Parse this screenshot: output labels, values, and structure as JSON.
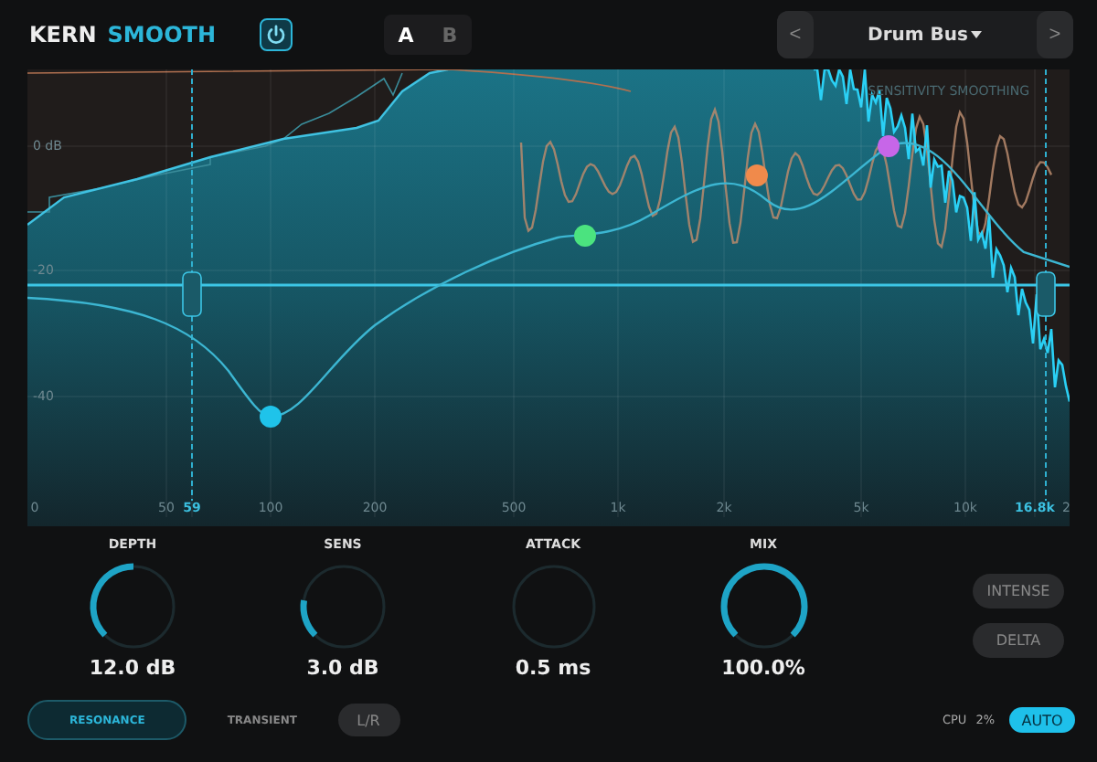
{
  "header": {
    "brand": "KERN",
    "mode": "SMOOTH",
    "power": {
      "on": true
    },
    "ab": [
      {
        "label": "A",
        "selected": true
      },
      {
        "label": "B",
        "selected": false
      }
    ],
    "preset": {
      "prev": "<",
      "name": "Drum Bus",
      "next": ">"
    }
  },
  "graph": {
    "db_labels": [
      "0 dB",
      "-20",
      "-40"
    ],
    "overlay_label": "SENSITIVITY SMOOTHING",
    "freq_labels": [
      {
        "text": "0",
        "kind": "tick"
      },
      {
        "text": "50",
        "kind": "tick"
      },
      {
        "text": "59",
        "kind": "band"
      },
      {
        "text": "100",
        "kind": "tick"
      },
      {
        "text": "200",
        "kind": "tick"
      },
      {
        "text": "500",
        "kind": "tick"
      },
      {
        "text": "1k",
        "kind": "tick"
      },
      {
        "text": "2k",
        "kind": "tick"
      },
      {
        "text": "5k",
        "kind": "tick"
      },
      {
        "text": "10k",
        "kind": "tick"
      },
      {
        "text": "16.8k",
        "kind": "band"
      },
      {
        "text": "2",
        "kind": "tick"
      }
    ],
    "nodes": [
      {
        "color": "#1fc3ea"
      },
      {
        "color": "#4be37f"
      },
      {
        "color": "#f08a4b"
      },
      {
        "color": "#c766e8"
      }
    ]
  },
  "knobs": [
    {
      "label": "DEPTH",
      "value": "12.0 dB"
    },
    {
      "label": "SENS",
      "value": "3.0 dB"
    },
    {
      "label": "ATTACK",
      "value": "0.5 ms"
    },
    {
      "label": "MIX",
      "value": "100.0%"
    }
  ],
  "side_buttons": [
    {
      "label": "INTENSE",
      "on": false
    },
    {
      "label": "DELTA",
      "on": false
    }
  ],
  "modes": [
    {
      "label": "RESONANCE",
      "selected": true
    },
    {
      "label": "TRANSIENT",
      "selected": false
    }
  ],
  "lr": {
    "label": "L/R",
    "on": false
  },
  "cpu": {
    "label": "CPU",
    "value": "2%"
  },
  "auto": {
    "label": "AUTO",
    "on": true
  }
}
